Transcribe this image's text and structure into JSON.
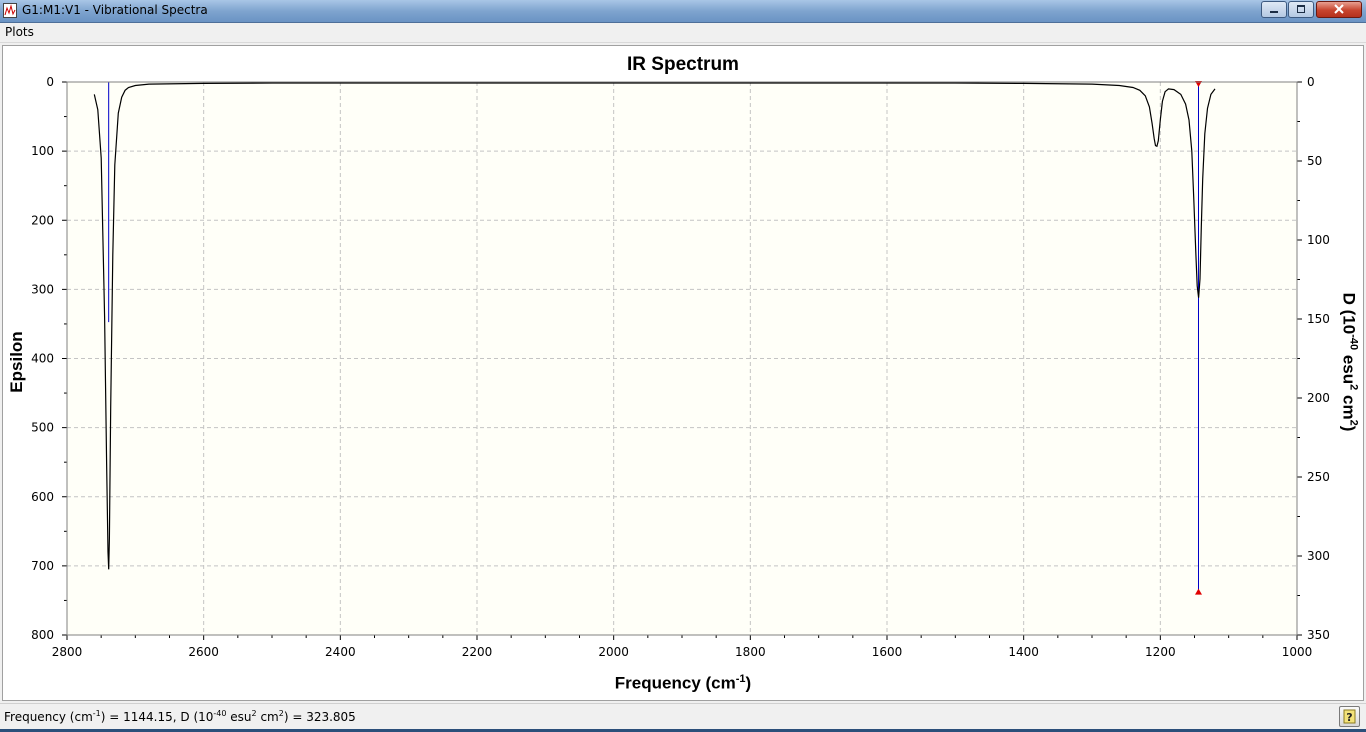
{
  "window": {
    "title": "G1:M1:V1 - Vibrational Spectra",
    "title_bar_color": "#7fa4cf",
    "icons": [
      "app-icon",
      "minimize-icon",
      "maximize-icon",
      "close-icon"
    ]
  },
  "menu": {
    "items": [
      {
        "label": "Plots"
      }
    ]
  },
  "status": {
    "freq_prefix": "Frequency (cm",
    "freq_exp": "-1",
    "freq_mid": ") = 1144.15, D (10",
    "d_exp": "-40",
    "d_mid": " esu",
    "d_sq": "2",
    "d_cm": " cm",
    "d_cm_sq": "2",
    "d_suffix": ") = 323.805",
    "help_icon": "help-icon"
  },
  "chart_data": {
    "type": "line",
    "title": "IR Spectrum",
    "xlabel": {
      "text": "Frequency (cm",
      "sup": "-1",
      "tail": ")"
    },
    "ylabel": "Epsilon",
    "y2label": {
      "parts": [
        "D (10",
        "-40",
        " esu",
        "2",
        " cm",
        "2",
        ")"
      ]
    },
    "xlim": [
      2800,
      1000
    ],
    "ylim": [
      0,
      800
    ],
    "y2lim": [
      0,
      350
    ],
    "x_reversed": true,
    "y_inverted": true,
    "xticks": [
      2800,
      2600,
      2400,
      2200,
      2000,
      1800,
      1600,
      1400,
      1200,
      1000
    ],
    "yticks": [
      0,
      100,
      200,
      300,
      400,
      500,
      600,
      700,
      800
    ],
    "y2ticks": [
      0,
      50,
      100,
      150,
      200,
      250,
      300,
      350
    ],
    "grid": true,
    "plot_background": "#fffff8",
    "curve_color": "#000000",
    "stick_color": "#0000c8",
    "marker_color": "#e00000",
    "peaks": [
      {
        "x": 2739,
        "epsilon": 705,
        "d": 152
      },
      {
        "x": 1205,
        "epsilon": 93,
        "d": 0
      },
      {
        "x": 1144.15,
        "epsilon": 312,
        "d": 323.805
      }
    ],
    "selected_peak": {
      "x": 1144.15,
      "d": 323.805
    },
    "curve": {
      "x": [
        2760,
        2755,
        2750,
        2745,
        2742,
        2740,
        2739,
        2738,
        2736,
        2733,
        2730,
        2725,
        2720,
        2715,
        2710,
        2700,
        2680,
        2600,
        2500,
        2400,
        2300,
        2200,
        2100,
        2000,
        1900,
        1800,
        1700,
        1600,
        1500,
        1400,
        1300,
        1260,
        1240,
        1230,
        1222,
        1216,
        1212,
        1209,
        1207,
        1205,
        1203,
        1200,
        1197,
        1193,
        1188,
        1180,
        1170,
        1163,
        1158,
        1154,
        1151,
        1148,
        1146,
        1144,
        1142,
        1140,
        1138,
        1135,
        1131,
        1126,
        1120
      ],
      "y": [
        18,
        40,
        110,
        340,
        550,
        680,
        705,
        660,
        470,
        250,
        120,
        45,
        22,
        12,
        8,
        5,
        3,
        2,
        1.5,
        1.5,
        1.5,
        1.5,
        1.5,
        1.5,
        1.5,
        1.5,
        1.5,
        1.5,
        1.5,
        2,
        3,
        5,
        8,
        12,
        20,
        36,
        60,
        82,
        92,
        93,
        85,
        55,
        28,
        14,
        10,
        11,
        18,
        32,
        55,
        100,
        170,
        250,
        295,
        312,
        285,
        210,
        140,
        75,
        38,
        18,
        10
      ]
    }
  }
}
